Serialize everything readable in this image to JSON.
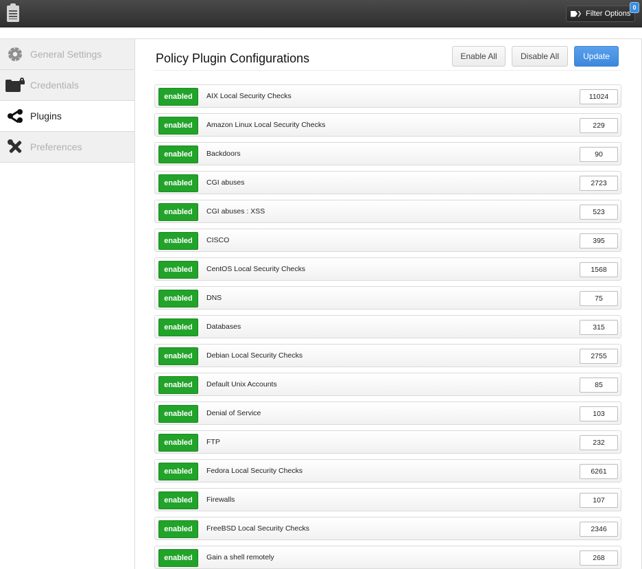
{
  "topbar": {
    "logo_icon": "clipboard-icon",
    "filter_button_label": "Filter Options",
    "filter_icon": "tags-icon",
    "filter_count": "0"
  },
  "sidebar": {
    "items": [
      {
        "label": "General Settings",
        "icon": "gear-icon",
        "active": false
      },
      {
        "label": "Credentials",
        "icon": "locked-folder-icon",
        "active": false
      },
      {
        "label": "Plugins",
        "icon": "share-icon",
        "active": true
      },
      {
        "label": "Preferences",
        "icon": "tools-icon",
        "active": false
      }
    ]
  },
  "main": {
    "title": "Policy Plugin Configurations",
    "enable_all_label": "Enable All",
    "disable_all_label": "Disable All",
    "update_label": "Update",
    "status_color": "#22a32a",
    "update_color": "#4a94e6",
    "families": [
      {
        "status": "enabled",
        "name": "AIX Local Security Checks",
        "count": "11024"
      },
      {
        "status": "enabled",
        "name": "Amazon Linux Local Security Checks",
        "count": "229"
      },
      {
        "status": "enabled",
        "name": "Backdoors",
        "count": "90"
      },
      {
        "status": "enabled",
        "name": "CGI abuses",
        "count": "2723"
      },
      {
        "status": "enabled",
        "name": "CGI abuses : XSS",
        "count": "523"
      },
      {
        "status": "enabled",
        "name": "CISCO",
        "count": "395"
      },
      {
        "status": "enabled",
        "name": "CentOS Local Security Checks",
        "count": "1568"
      },
      {
        "status": "enabled",
        "name": "DNS",
        "count": "75"
      },
      {
        "status": "enabled",
        "name": "Databases",
        "count": "315"
      },
      {
        "status": "enabled",
        "name": "Debian Local Security Checks",
        "count": "2755"
      },
      {
        "status": "enabled",
        "name": "Default Unix Accounts",
        "count": "85"
      },
      {
        "status": "enabled",
        "name": "Denial of Service",
        "count": "103"
      },
      {
        "status": "enabled",
        "name": "FTP",
        "count": "232"
      },
      {
        "status": "enabled",
        "name": "Fedora Local Security Checks",
        "count": "6261"
      },
      {
        "status": "enabled",
        "name": "Firewalls",
        "count": "107"
      },
      {
        "status": "enabled",
        "name": "FreeBSD Local Security Checks",
        "count": "2346"
      },
      {
        "status": "enabled",
        "name": "Gain a shell remotely",
        "count": "268"
      }
    ]
  }
}
